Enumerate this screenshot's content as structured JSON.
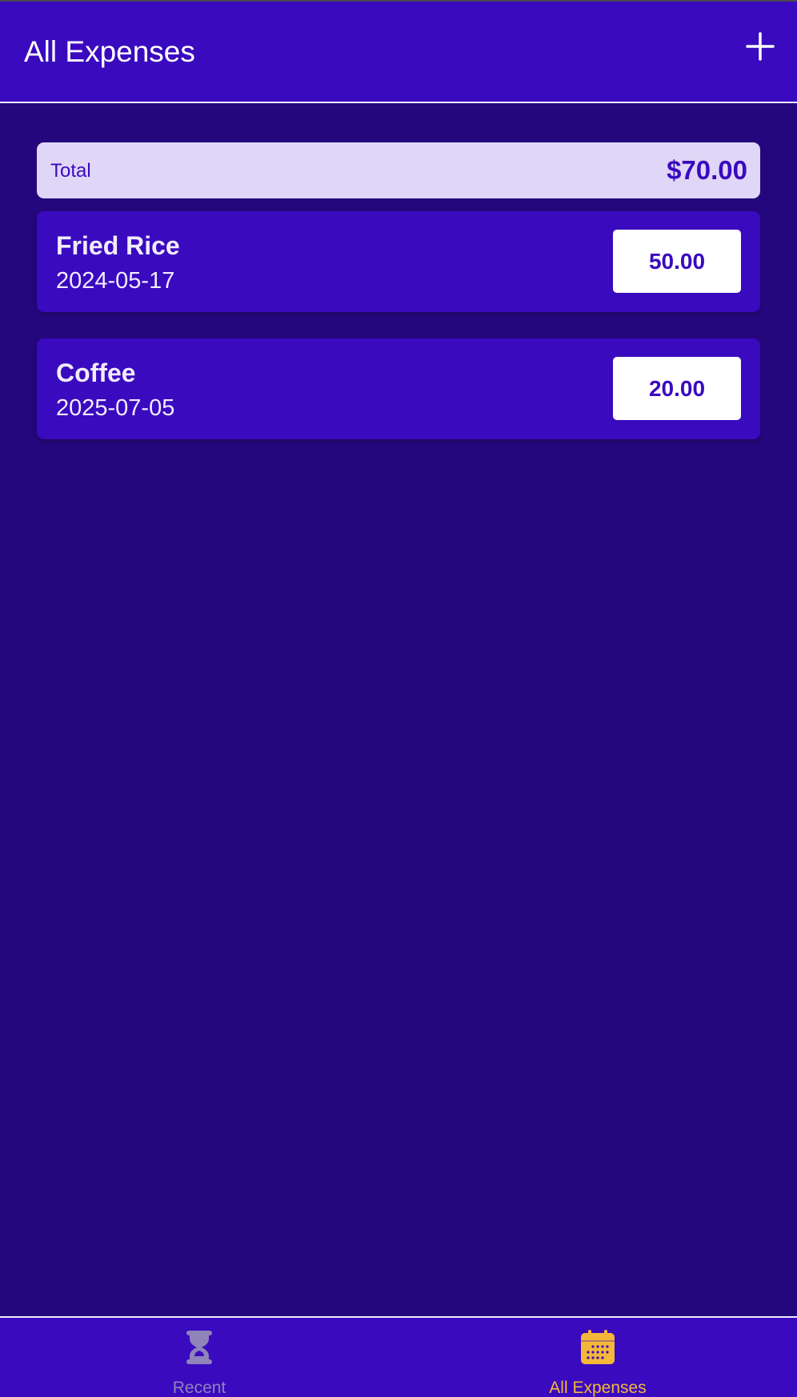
{
  "header": {
    "title": "All Expenses",
    "add_icon": "plus-icon"
  },
  "summary": {
    "label": "Total",
    "value": "$70.00"
  },
  "expenses": [
    {
      "name": "Fried Rice",
      "date": "2024-05-17",
      "amount": "50.00"
    },
    {
      "name": "Coffee",
      "date": "2025-07-05",
      "amount": "20.00"
    }
  ],
  "bottom_nav": {
    "items": [
      {
        "label": "Recent",
        "icon": "hourglass-icon",
        "active": false
      },
      {
        "label": "All Expenses",
        "icon": "calendar-icon",
        "active": true
      }
    ]
  },
  "colors": {
    "background": "#25077d",
    "primary": "#3a0abf",
    "accent": "#f4b73a",
    "summary_bg": "#e0d6f7",
    "inactive": "#8f83b8"
  }
}
